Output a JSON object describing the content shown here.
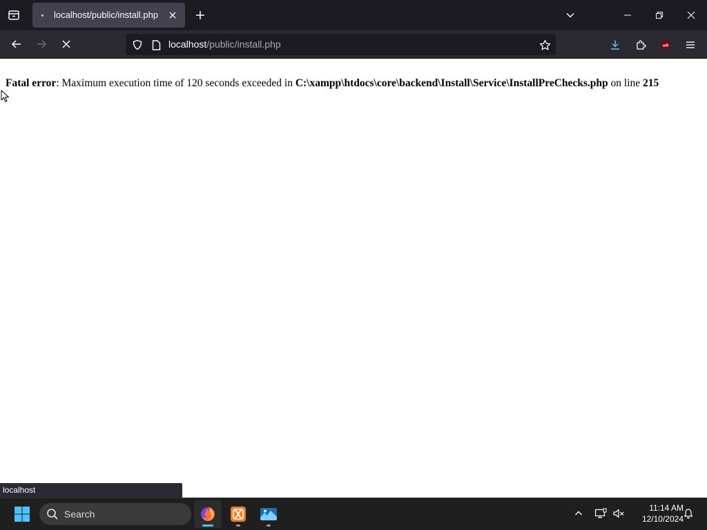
{
  "browser": {
    "tab": {
      "title": "localhost/public/install.php"
    },
    "url": {
      "host": "localhost",
      "path": "/public/install.php"
    }
  },
  "page": {
    "error": {
      "label": "Fatal error",
      "message_before": ": Maximum execution time of 120 seconds exceeded in ",
      "file": "C:\\xampp\\htdocs\\core\\backend\\Install\\Service\\InstallPreChecks.php",
      "message_mid": " on line ",
      "line": "215"
    }
  },
  "status_bar": {
    "text": "localhost"
  },
  "taskbar": {
    "search_label": "Search",
    "apps": [
      "firefox-icon",
      "xampp-icon",
      "photos-icon"
    ],
    "clock": {
      "time": "11:14 AM",
      "date": "12/10/2024"
    }
  },
  "colors": {
    "tabstrip": "#1c1b22",
    "navbar": "#2b2a33",
    "active_tab": "#42414d",
    "taskbar": "#1f1f1f",
    "accent": "#4cc2ff",
    "xampp": "#fb7a24"
  }
}
